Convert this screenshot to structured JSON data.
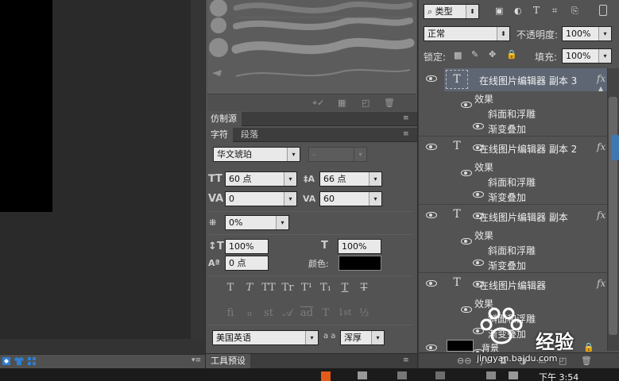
{
  "brush_panel": {
    "toolbar_icons": [
      "brush-presets-icon",
      "grid-icon",
      "new-icon",
      "trash-icon"
    ]
  },
  "clone_source": {
    "tab_label": "仿制源"
  },
  "character": {
    "tabs": [
      {
        "label": "字符"
      },
      {
        "label": "段落"
      }
    ],
    "font_family": "华文琥珀",
    "font_style": "-",
    "font_size": "60 点",
    "leading": "66 点",
    "kerning": "0",
    "tracking": "60",
    "tsume": "0%",
    "vertical_scale": "100%",
    "horizontal_scale": "100%",
    "baseline_shift": "0 点",
    "color_label": "颜色:",
    "color": "#000000",
    "type_buttons_row1": [
      "T",
      "T",
      "TT",
      "Tr",
      "T¹",
      "T₁",
      "T",
      "T"
    ],
    "type_buttons_row2": [
      "fi",
      "ℴ",
      "st",
      "𝒜",
      "ad",
      "T",
      "1st",
      "½"
    ],
    "language": "美国英语",
    "aa_label": "a a",
    "antialias": "浑厚"
  },
  "tool_presets": {
    "tab_label": "工具预设"
  },
  "layers": {
    "filter_kind": "类型",
    "blend_mode": "正常",
    "opacity_label": "不透明度:",
    "opacity": "100%",
    "lock_label": "锁定:",
    "fill_label": "填充:",
    "fill": "100%",
    "items": [
      {
        "name": "在线图片编辑器 副本 3",
        "selected": true,
        "effects_label": "效果",
        "effects": [
          "斜面和浮雕",
          "渐变叠加"
        ]
      },
      {
        "name": "在线图片编辑器 副本 2",
        "selected": false,
        "effects_label": "效果",
        "effects": [
          "斜面和浮雕",
          "渐变叠加"
        ]
      },
      {
        "name": "在线图片编辑器 副本",
        "selected": false,
        "effects_label": "效果",
        "effects": [
          "斜面和浮雕",
          "渐变叠加"
        ]
      },
      {
        "name": "在线图片编辑器",
        "selected": false,
        "effects_label": "效果",
        "effects": [
          "斜面和浮雕",
          "渐变叠加"
        ]
      }
    ],
    "last_layer_partial": "背景"
  },
  "taskbar": {
    "clock": "下午 3:54"
  },
  "watermark": {
    "text": "经验",
    "sub": "jingyan.baidu.com"
  }
}
